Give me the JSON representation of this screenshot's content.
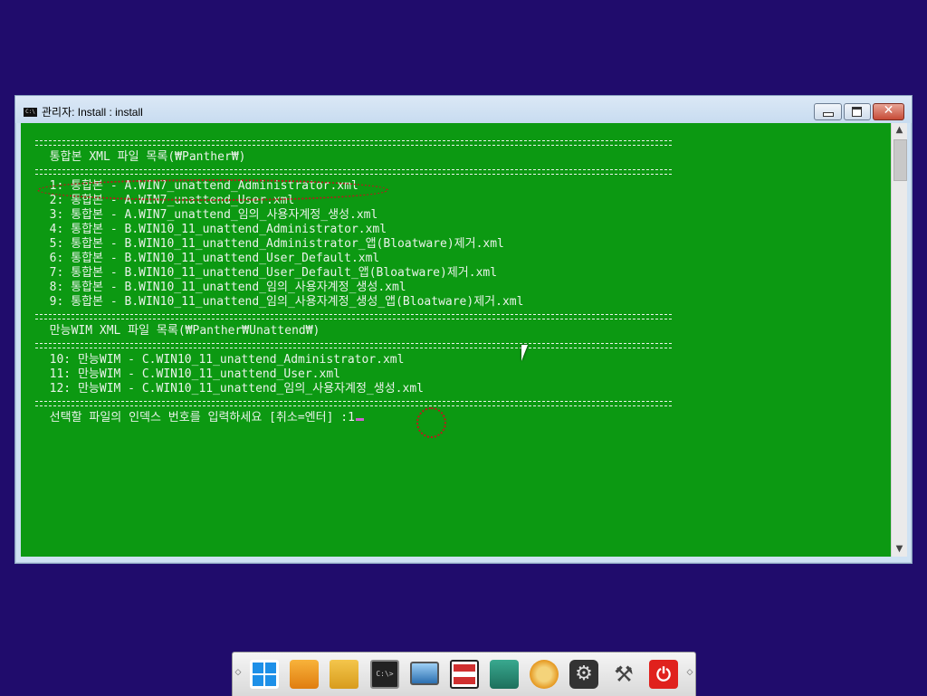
{
  "window": {
    "title": "관리자:  Install : install",
    "icon": "console-icon"
  },
  "console": {
    "lines": [
      {
        "kind": "sep"
      },
      {
        "kind": "text",
        "text": "  통합본 XML 파일 목록(₩Panther₩)"
      },
      {
        "kind": "sep"
      },
      {
        "kind": "text",
        "text": "  1: 통합본 - A.WIN7_unattend_Administrator.xml"
      },
      {
        "kind": "text",
        "text": "  2: 통합본 - A.WIN7_unattend_User.xml"
      },
      {
        "kind": "text",
        "text": "  3: 통합본 - A.WIN7_unattend_임의_사용자계정_생성.xml"
      },
      {
        "kind": "text",
        "text": "  4: 통합본 - B.WIN10_11_unattend_Administrator.xml"
      },
      {
        "kind": "text",
        "text": "  5: 통합본 - B.WIN10_11_unattend_Administrator_앱(Bloatware)제거.xml"
      },
      {
        "kind": "text",
        "text": "  6: 통합본 - B.WIN10_11_unattend_User_Default.xml"
      },
      {
        "kind": "text",
        "text": "  7: 통합본 - B.WIN10_11_unattend_User_Default_앱(Bloatware)제거.xml"
      },
      {
        "kind": "text",
        "text": "  8: 통합본 - B.WIN10_11_unattend_임의_사용자계정_생성.xml"
      },
      {
        "kind": "text",
        "text": "  9: 통합본 - B.WIN10_11_unattend_임의_사용자계정_생성_앱(Bloatware)제거.xml"
      },
      {
        "kind": "sep"
      },
      {
        "kind": "text",
        "text": "  만능WIM XML 파일 목록(₩Panther₩Unattend₩)"
      },
      {
        "kind": "sep"
      },
      {
        "kind": "text",
        "text": "  10: 만능WIM - C.WIN10_11_unattend_Administrator.xml"
      },
      {
        "kind": "text",
        "text": "  11: 만능WIM - C.WIN10_11_unattend_User.xml"
      },
      {
        "kind": "text",
        "text": "  12: 만능WIM - C.WIN10_11_unattend_임의_사용자계정_생성.xml"
      },
      {
        "kind": "sep"
      }
    ],
    "prompt": "  선택할 파일의 인덱스 번호를 입력하세요 [취소=엔터] :",
    "input_value": "1"
  },
  "dock": {
    "icons": [
      "windows-icon",
      "usb-drive-icon",
      "folder-search-icon",
      "command-prompt-icon",
      "monitor-icon",
      "drives-icon",
      "disk-icon",
      "sync-icon",
      "settings-gear-icon",
      "tools-icon",
      "power-icon"
    ]
  },
  "colors": {
    "desktop": "#200c6c",
    "console_bg": "#0c9912",
    "console_text": "#e9f3e9",
    "highlight": "#c0161b"
  }
}
